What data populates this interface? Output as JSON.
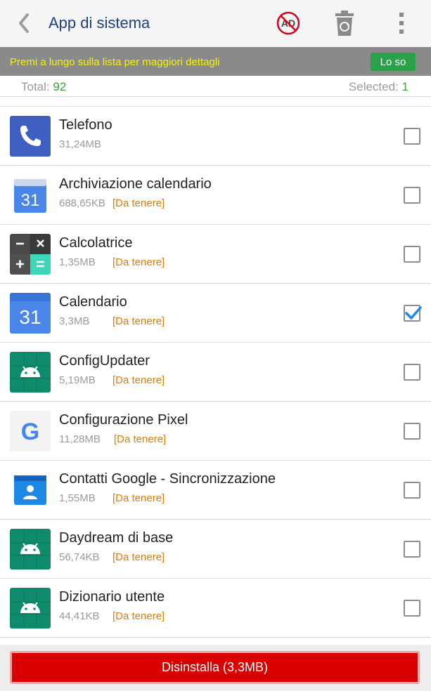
{
  "header": {
    "title": "App di sistema",
    "back_icon": "chevron-left-icon",
    "actions": [
      {
        "icon": "no-ads-icon",
        "text": "AD"
      },
      {
        "icon": "recycle-bin-icon"
      },
      {
        "icon": "overflow-menu-icon"
      }
    ]
  },
  "banner": {
    "text": "Premi a lungo sulla lista per maggiori dettagli",
    "button_label": "Lo so",
    "text_color": "#f5f200",
    "button_color": "#2aa14a"
  },
  "stats": {
    "total_label": "Total:",
    "total_value": "92",
    "selected_label": "Selected:",
    "selected_value": "1"
  },
  "apps": [
    {
      "name": "Telefono",
      "size": "31,24MB",
      "tag": "",
      "icon": "phone-icon",
      "checked": false
    },
    {
      "name": "Archiviazione calendario",
      "size": "688,65KB",
      "tag": "[Da tenere]",
      "icon": "calendar-storage-icon",
      "icon_text": "31",
      "checked": false
    },
    {
      "name": "Calcolatrice",
      "size": "1,35MB",
      "tag": "[Da tenere]",
      "icon": "calculator-icon",
      "checked": false
    },
    {
      "name": "Calendario",
      "size": "3,3MB",
      "tag": "[Da tenere]",
      "icon": "calendar-icon",
      "icon_text": "31",
      "checked": true
    },
    {
      "name": "ConfigUpdater",
      "size": "5,19MB",
      "tag": "[Da tenere]",
      "icon": "android-icon",
      "checked": false
    },
    {
      "name": "Configurazione Pixel",
      "size": "11,28MB",
      "tag": "[Da tenere]",
      "icon": "google-icon",
      "icon_text": "G",
      "checked": false
    },
    {
      "name": "Contatti Google - Sincronizzazione",
      "size": "1,55MB",
      "tag": "[Da tenere]",
      "icon": "contacts-icon",
      "checked": false
    },
    {
      "name": "Daydream di base",
      "size": "56,74KB",
      "tag": "[Da tenere]",
      "icon": "android-icon",
      "checked": false
    },
    {
      "name": "Dizionario utente",
      "size": "44,41KB",
      "tag": "[Da tenere]",
      "icon": "android-icon",
      "checked": false
    }
  ],
  "footer": {
    "uninstall_label": "Disinstalla (3,3MB)",
    "button_color": "#d90000"
  }
}
